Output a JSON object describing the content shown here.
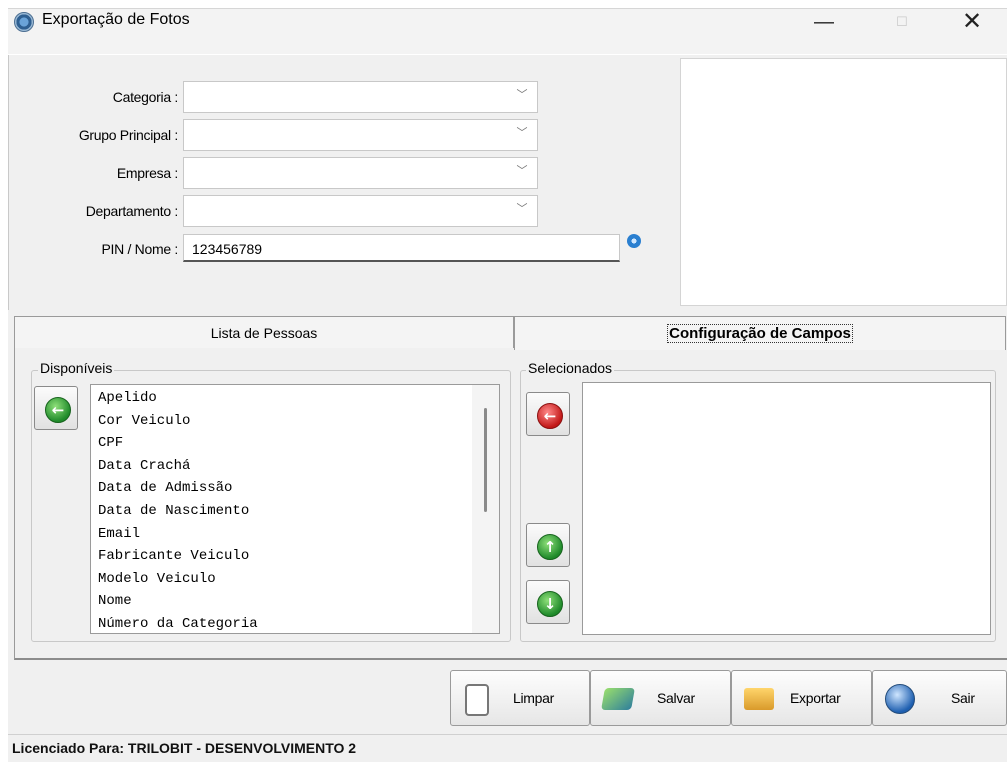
{
  "window": {
    "title": "Exportação de Fotos",
    "minimize_glyph": "—",
    "maximize_glyph": "☐",
    "close_glyph": "✕"
  },
  "filters": {
    "categoria_label": "Categoria",
    "grupo_label": "Grupo Principal",
    "empresa_label": "Empresa",
    "departamento_label": "Departamento",
    "pin_label": "PIN / Nome",
    "pin_value": "123456789",
    "colon": ":",
    "chevron": "﹀"
  },
  "tabs": [
    {
      "label": "Lista de Pessoas",
      "active": false
    },
    {
      "label": "Configuração de Campos",
      "active": true
    }
  ],
  "disponiveis": {
    "title": "Disponíveis",
    "items": [
      "Apelido",
      "Cor Veiculo",
      "CPF",
      "Data Crachá",
      "Data de Admissão",
      "Data de Nascimento",
      "Email",
      "Fabricante Veiculo",
      "Modelo Veiculo",
      "Nome",
      "Número da Categoria"
    ]
  },
  "selecionados": {
    "title": "Selecionados",
    "items": []
  },
  "arrows": {
    "add": "←",
    "remove": "←",
    "up": "↑",
    "down": "↓"
  },
  "actions": {
    "limpar": "Limpar",
    "salvar": "Salvar",
    "exportar": "Exportar",
    "sair": "Sair"
  },
  "status": {
    "text": "Licenciado Para: TRILOBIT - DESENVOLVIMENTO 2"
  },
  "icons": {
    "app": "camera-app-icon",
    "refresh": "refresh-icon",
    "limpar": "blank-page-icon",
    "salvar": "save-icon",
    "exportar": "folder-export-icon",
    "sair": "globe-exit-icon"
  }
}
